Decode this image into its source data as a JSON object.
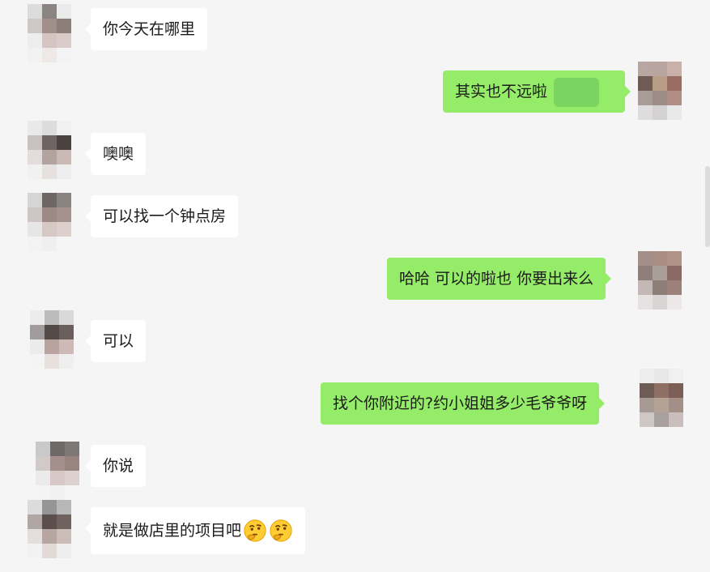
{
  "chat": {
    "messages": [
      {
        "side": "left",
        "text": "你今天在哪里"
      },
      {
        "side": "right",
        "text": "其实也不远啦",
        "has_blurred_content": true
      },
      {
        "side": "left",
        "text": "噢噢"
      },
      {
        "side": "left",
        "text": "可以找一个钟点房"
      },
      {
        "side": "right",
        "text": "哈哈 可以的啦也 你要出来么"
      },
      {
        "side": "left",
        "text": "可以"
      },
      {
        "side": "right",
        "text": "找个你附近的?约小姐姐多少毛爷爷呀"
      },
      {
        "side": "left",
        "text": "你说"
      },
      {
        "side": "left",
        "text": "就是做店里的项目吧",
        "trailing_icons": [
          "thinking-face-emoji",
          "thinking-face-emoji"
        ]
      }
    ]
  },
  "colors": {
    "background": "#f5f5f5",
    "left_bubble": "#ffffff",
    "right_bubble": "#95ec69",
    "text": "#1a1a1a"
  }
}
